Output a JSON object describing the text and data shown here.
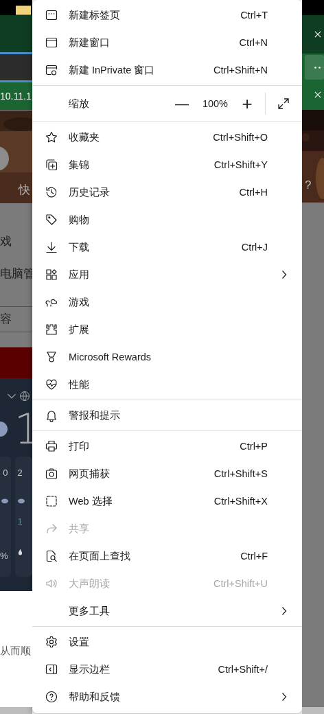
{
  "background": {
    "address_fragment": "10.11.1",
    "hero_caption": "快",
    "hero_caption_right": "?",
    "list_items": [
      "戏",
      "电脑管"
    ],
    "tab_label": "容",
    "weather_temp": "1",
    "weather_cards": [
      {
        "temp": "0",
        "humidity": "%"
      },
      {
        "temp": "2",
        "rain": "1"
      }
    ],
    "footer_text": "从而顺"
  },
  "menu": {
    "groups": [
      {
        "items": [
          {
            "kind": "item",
            "label": "新建标签页",
            "shortcut": "Ctrl+T",
            "disabled": false
          },
          {
            "kind": "item",
            "label": "新建窗口",
            "shortcut": "Ctrl+N",
            "disabled": false
          },
          {
            "kind": "item",
            "label": "新建 InPrivate 窗口",
            "shortcut": "Ctrl+Shift+N",
            "disabled": false
          }
        ]
      },
      {
        "items": [
          {
            "kind": "zoom",
            "label": "缩放",
            "minus": "—",
            "value": "100%",
            "plus": "+"
          }
        ]
      },
      {
        "items": [
          {
            "kind": "item",
            "label": "收藏夹",
            "shortcut": "Ctrl+Shift+O",
            "disabled": false
          },
          {
            "kind": "item",
            "label": "集锦",
            "shortcut": "Ctrl+Shift+Y",
            "disabled": false
          },
          {
            "kind": "item",
            "label": "历史记录",
            "shortcut": "Ctrl+H",
            "disabled": false
          },
          {
            "kind": "item",
            "label": "购物",
            "disabled": false
          },
          {
            "kind": "item",
            "label": "下载",
            "shortcut": "Ctrl+J",
            "disabled": false
          },
          {
            "kind": "item",
            "label": "应用",
            "disabled": false,
            "submenu": true
          },
          {
            "kind": "item",
            "label": "游戏",
            "disabled": false
          },
          {
            "kind": "item",
            "label": "扩展",
            "disabled": false
          },
          {
            "kind": "item",
            "label": "Microsoft Rewards",
            "disabled": false
          },
          {
            "kind": "item",
            "label": "性能",
            "disabled": false
          }
        ]
      },
      {
        "items": [
          {
            "kind": "item",
            "label": "警报和提示",
            "disabled": false
          }
        ]
      },
      {
        "items": [
          {
            "kind": "item",
            "label": "打印",
            "shortcut": "Ctrl+P",
            "disabled": false
          },
          {
            "kind": "item",
            "label": "网页捕获",
            "shortcut": "Ctrl+Shift+S",
            "disabled": false
          },
          {
            "kind": "item",
            "label": "Web 选择",
            "shortcut": "Ctrl+Shift+X",
            "disabled": false
          },
          {
            "kind": "item",
            "label": "共享",
            "disabled": true
          },
          {
            "kind": "item",
            "label": "在页面上查找",
            "shortcut": "Ctrl+F",
            "disabled": false
          },
          {
            "kind": "item",
            "label": "大声朗读",
            "shortcut": "Ctrl+Shift+U",
            "disabled": true
          },
          {
            "kind": "item",
            "label": "更多工具",
            "disabled": false,
            "submenu": true
          }
        ]
      },
      {
        "items": [
          {
            "kind": "item",
            "label": "设置",
            "disabled": false
          },
          {
            "kind": "item",
            "label": "显示边栏",
            "shortcut": "Ctrl+Shift+/",
            "disabled": false
          },
          {
            "kind": "item",
            "label": "帮助和反馈",
            "disabled": false,
            "submenu": true
          }
        ]
      }
    ]
  }
}
